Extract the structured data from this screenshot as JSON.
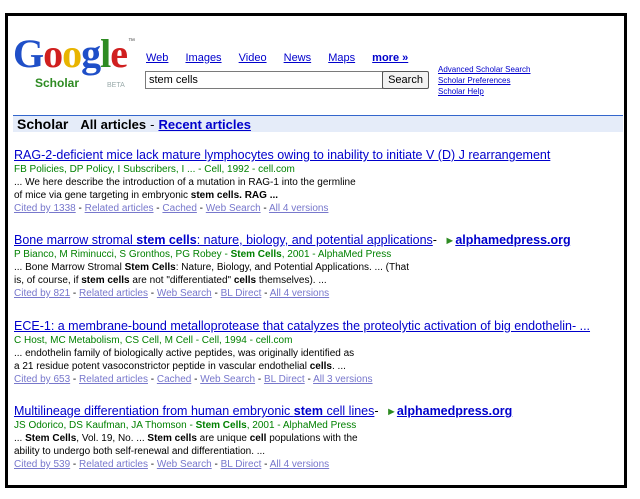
{
  "logo": {
    "letters": [
      {
        "ch": "G",
        "color": "#1f4fc8"
      },
      {
        "ch": "o",
        "color": "#d01f1f"
      },
      {
        "ch": "o",
        "color": "#e8b400"
      },
      {
        "ch": "g",
        "color": "#1f4fc8"
      },
      {
        "ch": "l",
        "color": "#2e8b22"
      },
      {
        "ch": "e",
        "color": "#d01f1f"
      }
    ],
    "tm": "™",
    "scholar": "Scholar",
    "beta": "BETA"
  },
  "nav": {
    "web": "Web",
    "images": "Images",
    "video": "Video",
    "news": "News",
    "maps": "Maps",
    "more": "more »"
  },
  "search": {
    "value": "stem cells",
    "button": "Search"
  },
  "side_links": {
    "advanced": "Advanced Scholar Search",
    "preferences": "Scholar Preferences",
    "help": "Scholar Help"
  },
  "bar": {
    "title": "Scholar",
    "all_articles": "All articles",
    "separator": "-",
    "recent": "Recent articles"
  },
  "results": [
    {
      "title": "RAG-2-deficient mice lack mature lymphocytes owing to inability to initiate V (D) J rearrangement",
      "meta": "FB Policies, DP Policy, I Subscribers, I ... - Cell, 1992 - cell.com",
      "snippet1": "... We here describe the introduction of a mutation in RAG-1 into the germline",
      "snippet2_pre": "of mice via gene targeting in embryonic ",
      "snippet2_bold": "stem cells",
      "snippet2_post": ". RAG ...",
      "links": [
        "Cited by 1338",
        "Related articles",
        "Cached",
        "Web Search",
        "All 4 versions"
      ]
    },
    {
      "title_pre": "Bone marrow stromal ",
      "title_bold": "stem cells",
      "title_post": ": nature, biology, and potential applications",
      "dash": "- ",
      "arrow": "►",
      "domain": "alphamedpress.org",
      "meta_pre": "P Bianco, M Riminucci, S Gronthos, PG Robey - ",
      "meta_bold": "Stem Cells",
      "meta_post": ", 2001 - AlphaMed Press",
      "snippet1_pre": "... Bone Marrow Stromal ",
      "snippet1_bold": "Stem Cells",
      "snippet1_post": ": Nature, Biology, and Potential Applications. ... (That",
      "snippet2_pre": "is, of course, if ",
      "snippet2_bold": "stem cells",
      "snippet2_mid": " are not \"differentiated\" ",
      "snippet2_bold2": "cells",
      "snippet2_post": " themselves). ...",
      "links": [
        "Cited by 821",
        "Related articles",
        "Web Search",
        "BL Direct",
        "All 4 versions"
      ]
    },
    {
      "title": "ECE-1: a membrane-bound metalloprotease that catalyzes the proteolytic activation of big endothelin- ...",
      "meta": "C Host, MC Metabolism, CS Cell, M Cell - Cell, 1994 - cell.com",
      "snippet1": "... endothelin family of biologically active peptides, was originally identified as",
      "snippet2_pre": "a 21 residue potent vasoconstrictor peptide in vascular endothelial ",
      "snippet2_bold": "cells",
      "snippet2_post": ". ...",
      "links": [
        "Cited by 653",
        "Related articles",
        "Cached",
        "Web Search",
        "BL Direct",
        "All 3 versions"
      ]
    },
    {
      "title_pre": "Multilineage differentiation from human embryonic ",
      "title_bold": "stem",
      "title_post": " cell lines",
      "dash": "- ",
      "arrow": "►",
      "domain": "alphamedpress.org",
      "meta_pre": "JS Odorico, DS Kaufman, JA Thomson - ",
      "meta_bold": "Stem Cells",
      "meta_post": ", 2001 - AlphaMed Press",
      "snippet1_pre": "... ",
      "snippet1_bold": "Stem Cells",
      "snippet1_mid": ", Vol. 19, No. ... ",
      "snippet1_bold2": "Stem cells",
      "snippet1_mid2": " are unique ",
      "snippet1_bold3": "cell",
      "snippet1_post": " populations with the",
      "snippet2": "ability to undergo both self-renewal and differentiation. ...",
      "links": [
        "Cited by 539",
        "Related articles",
        "Web Search",
        "BL Direct",
        "All 4 versions"
      ]
    }
  ]
}
